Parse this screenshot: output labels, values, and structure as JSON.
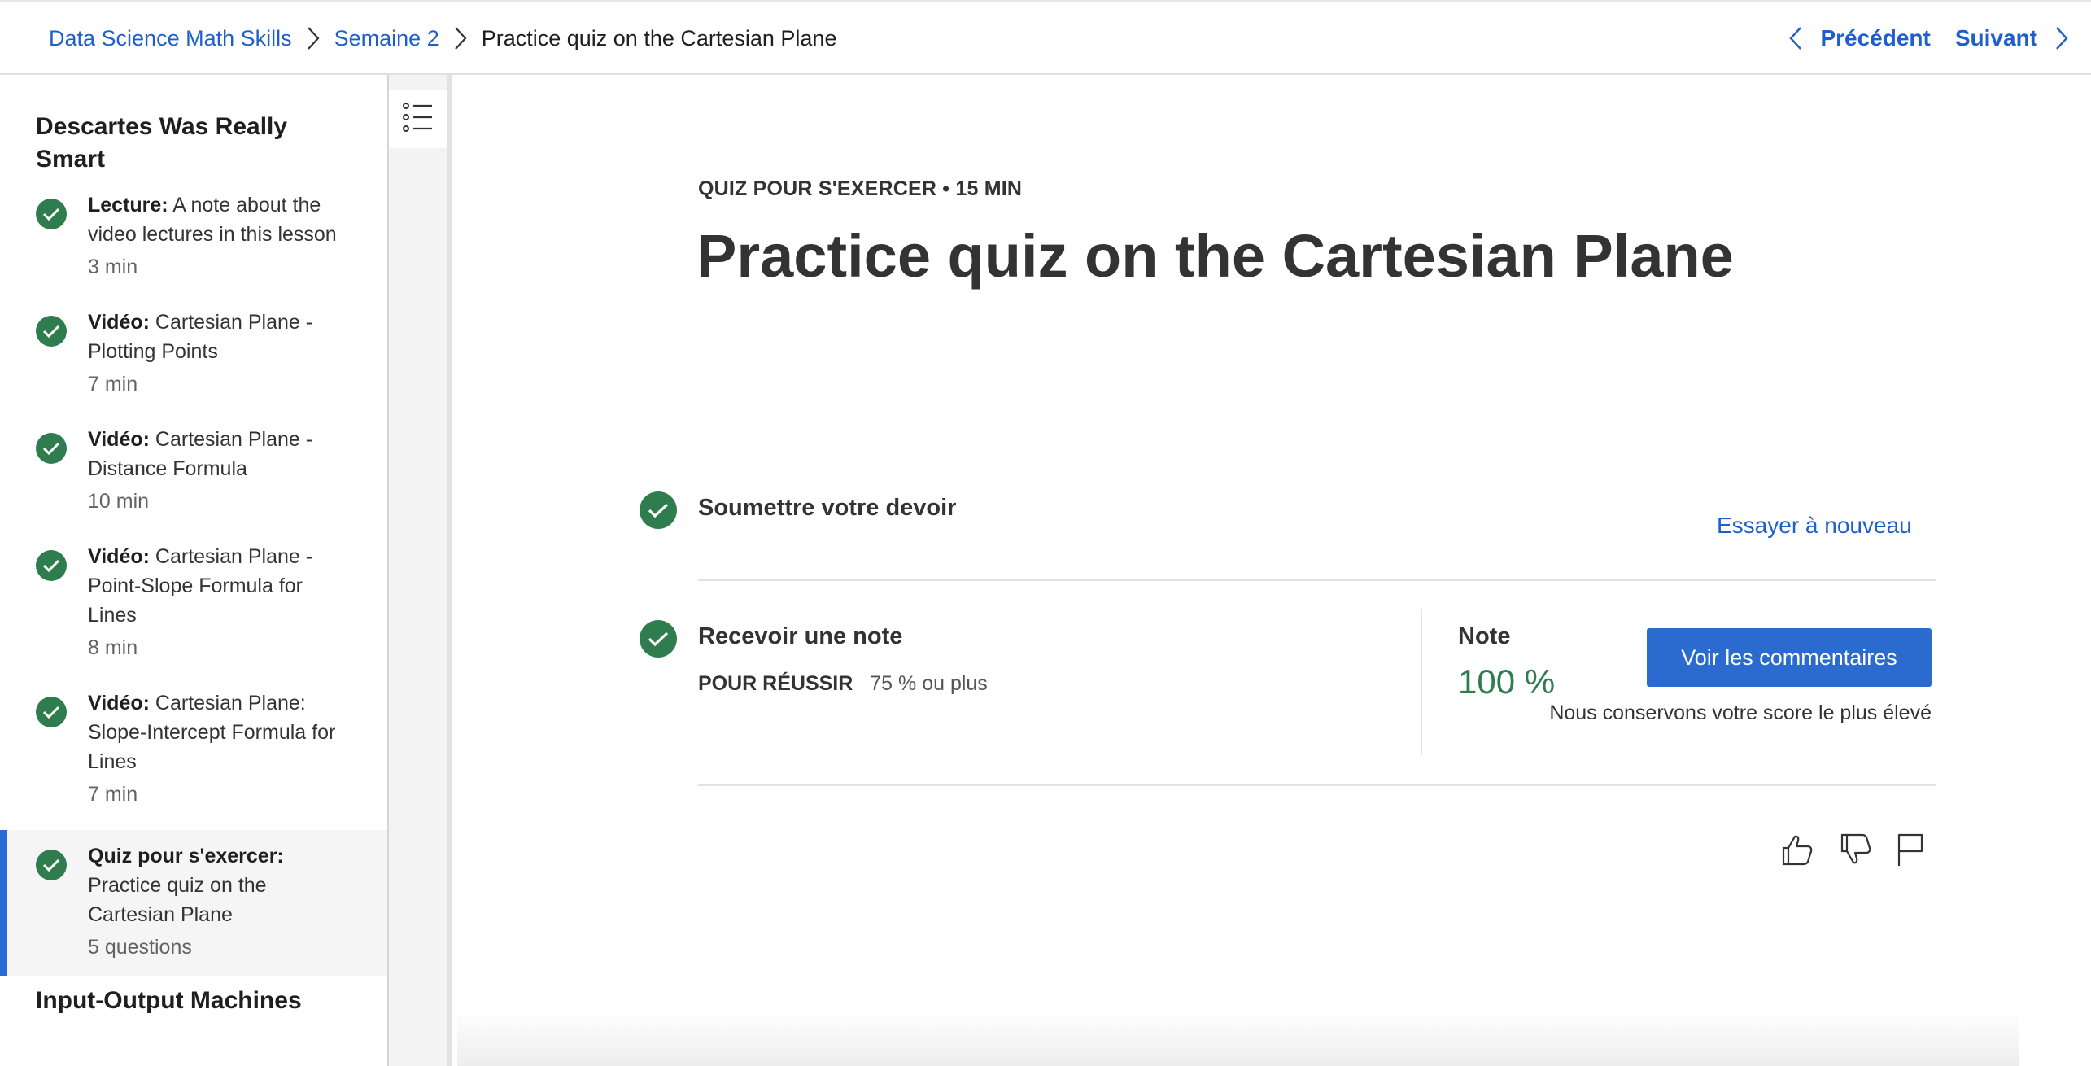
{
  "breadcrumb": {
    "course": "Data Science Math Skills",
    "week": "Semaine 2",
    "current": "Practice quiz on the Cartesian Plane"
  },
  "nav": {
    "previous": "Précédent",
    "next": "Suivant"
  },
  "sidebar": {
    "module_title": "Descartes Was Really Smart",
    "items": [
      {
        "type": "Lecture:",
        "title": "A note about the video lectures in this lesson",
        "duration": "3 min",
        "completed": true
      },
      {
        "type": "Vidéo:",
        "title": "Cartesian Plane - Plotting Points",
        "duration": "7 min",
        "completed": true
      },
      {
        "type": "Vidéo:",
        "title": "Cartesian Plane - Distance Formula",
        "duration": "10 min",
        "completed": true
      },
      {
        "type": "Vidéo:",
        "title": "Cartesian Plane - Point-Slope Formula for Lines",
        "duration": "8 min",
        "completed": true
      },
      {
        "type": "Vidéo:",
        "title": "Cartesian Plane: Slope-Intercept Formula for Lines",
        "duration": "7 min",
        "completed": true
      },
      {
        "type": "Quiz pour s'exercer:",
        "title": "Practice quiz on the Cartesian Plane",
        "duration": "5 questions",
        "completed": true,
        "active": true
      }
    ],
    "next_module_title": "Input-Output Machines"
  },
  "main": {
    "kicker": "QUIZ POUR S'EXERCER • 15 MIN",
    "title": "Practice quiz on the Cartesian Plane",
    "submit": {
      "label": "Soumettre votre devoir",
      "retry": "Essayer à nouveau"
    },
    "grade": {
      "label": "Recevoir une note",
      "pass_label": "POUR RÉUSSIR",
      "pass_value": "75 % ou plus",
      "note_label": "Note",
      "note_value": "100 %",
      "feedback_button": "Voir les commentaires",
      "keep_note": "Nous conservons votre score le plus élevé"
    }
  },
  "colors": {
    "link": "#1f5fcc",
    "success": "#2f7d4e",
    "primary_button": "#2b6bd0",
    "active_indicator": "#2b6bd6"
  },
  "icons": [
    "chevron-right-icon",
    "chevron-left-icon",
    "checkmark-icon",
    "list-icon",
    "thumbs-up-icon",
    "thumbs-down-icon",
    "flag-icon"
  ]
}
